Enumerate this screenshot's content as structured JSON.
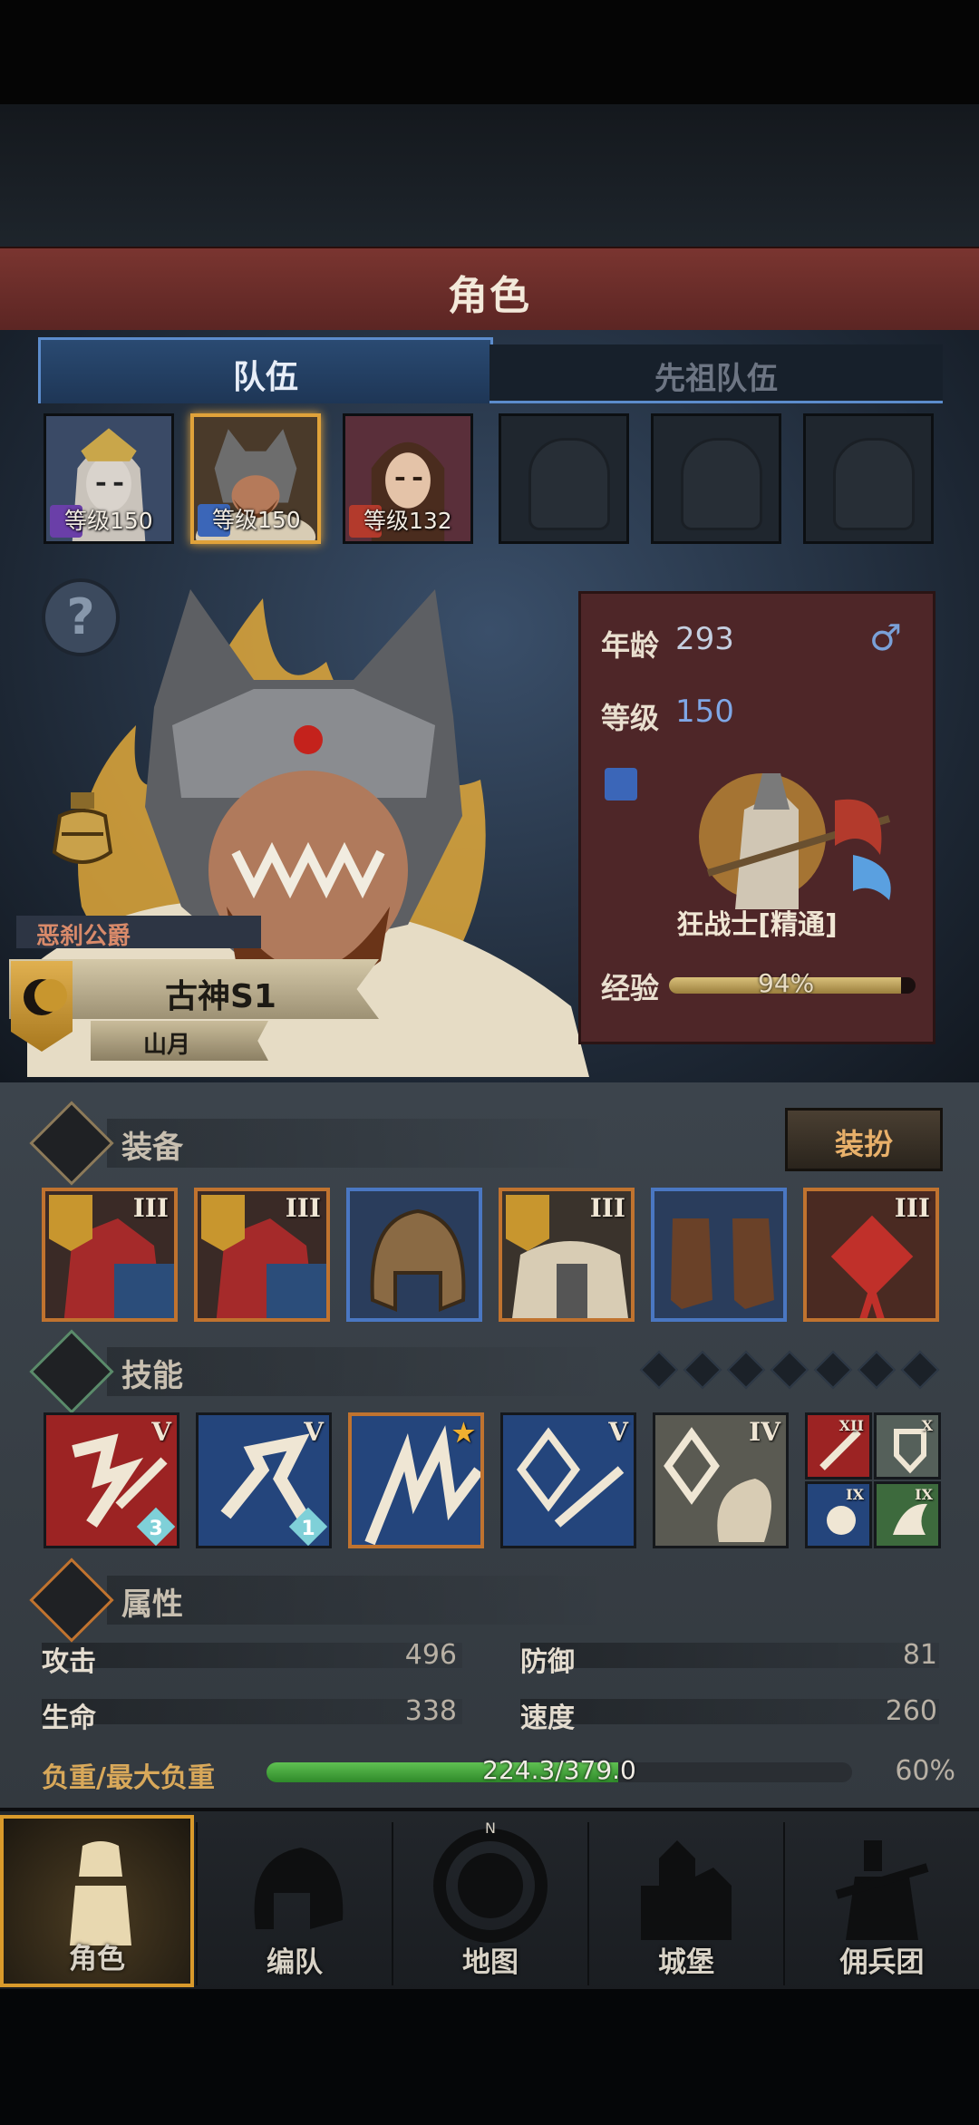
{
  "header": {
    "title": "角色"
  },
  "tabs": [
    {
      "label": "队伍",
      "active": true
    },
    {
      "label": "先祖队伍",
      "active": false
    }
  ],
  "party": [
    {
      "level_text": "等级150",
      "class_icon": "staff-icon",
      "color": "#6a3fa8"
    },
    {
      "level_text": "等级150",
      "class_icon": "sword-icon",
      "color": "#3b66b8",
      "selected": true
    },
    {
      "level_text": "等级132",
      "class_icon": "fist-icon",
      "color": "#b33a2c"
    },
    {
      "empty": true
    },
    {
      "empty": true
    },
    {
      "empty": true
    }
  ],
  "character": {
    "title": "恶刹公爵",
    "name": "古神S1",
    "origin": "山月",
    "age_label": "年龄",
    "age": "293",
    "gender_icon": "male-icon",
    "level_label": "等级",
    "level": "150",
    "class_name": "狂战士[精通]",
    "exp_label": "经验",
    "exp_percent_text": "94%",
    "exp_fraction": 0.94
  },
  "equipment": {
    "title": "装备",
    "dress_button": "装扮",
    "items": [
      {
        "rank": "III",
        "border": "orange",
        "crest": true,
        "name": "armor-set"
      },
      {
        "rank": "III",
        "border": "orange",
        "crest": true,
        "name": "armor-set-2"
      },
      {
        "rank": "",
        "border": "blue",
        "crest": false,
        "name": "helmet"
      },
      {
        "rank": "III",
        "border": "orange",
        "crest": true,
        "name": "fur-armor"
      },
      {
        "rank": "",
        "border": "blue",
        "crest": false,
        "name": "boots"
      },
      {
        "rank": "III",
        "border": "orange",
        "crest": false,
        "name": "knot-charm"
      }
    ]
  },
  "skills": {
    "title": "技能",
    "slots_total": 7,
    "items": [
      {
        "rank": "V",
        "badge": "3",
        "bg": "#9c2323"
      },
      {
        "rank": "V",
        "badge": "1",
        "bg": "#24457c"
      },
      {
        "rank": "★",
        "badge": "",
        "bg": "#24457c"
      },
      {
        "rank": "V",
        "badge": "",
        "bg": "#24457c"
      },
      {
        "rank": "IV",
        "badge": "",
        "bg": "#5a5a52"
      }
    ],
    "small": [
      {
        "rank": "XII",
        "bg": "#9c2323"
      },
      {
        "rank": "X",
        "bg": "#55605a"
      },
      {
        "rank": "IX",
        "bg": "#24457c"
      },
      {
        "rank": "IX",
        "bg": "#3d6a3d"
      }
    ]
  },
  "attributes": {
    "title": "属性",
    "attack_label": "攻击",
    "attack": "496",
    "defense_label": "防御",
    "defense": "81",
    "hp_label": "生命",
    "hp": "338",
    "speed_label": "速度",
    "speed": "260",
    "load_label": "负重/最大负重",
    "load_text": "224.3/379.0",
    "load_percent_text": "60%",
    "load_fraction": 0.6
  },
  "nav": [
    {
      "label": "角色",
      "icon": "knight-icon",
      "active": true
    },
    {
      "label": "编队",
      "icon": "helmet-icon",
      "active": false
    },
    {
      "label": "地图",
      "icon": "compass-icon",
      "active": false
    },
    {
      "label": "城堡",
      "icon": "castle-icon",
      "active": false
    },
    {
      "label": "佣兵团",
      "icon": "mercenary-icon",
      "active": false
    }
  ],
  "colors": {
    "accent_gold": "#e0a23a",
    "tab_blue": "#5c8ccc",
    "load_green": "#3fa83a",
    "title_red": "#7a3530"
  }
}
